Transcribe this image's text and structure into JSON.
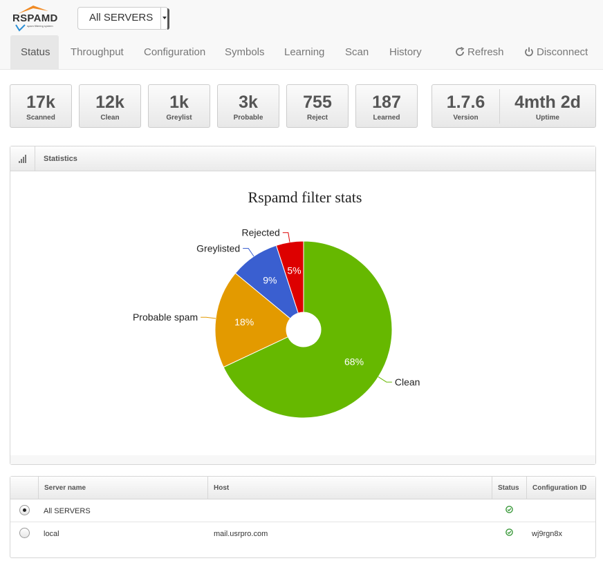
{
  "app": {
    "logo_text": "RSPAMD",
    "logo_tagline": "spam filtering system"
  },
  "server_select": {
    "value": "All SERVERS"
  },
  "nav": {
    "tabs": [
      {
        "label": "Status"
      },
      {
        "label": "Throughput"
      },
      {
        "label": "Configuration"
      },
      {
        "label": "Symbols"
      },
      {
        "label": "Learning"
      },
      {
        "label": "Scan"
      },
      {
        "label": "History"
      }
    ],
    "refresh_label": "Refresh",
    "disconnect_label": "Disconnect",
    "refresh_icon": "refresh-icon",
    "disconnect_icon": "power-icon"
  },
  "stats": [
    {
      "value": "17k",
      "label": "Scanned"
    },
    {
      "value": "12k",
      "label": "Clean"
    },
    {
      "value": "1k",
      "label": "Greylist"
    },
    {
      "value": "3k",
      "label": "Probable"
    },
    {
      "value": "755",
      "label": "Reject"
    },
    {
      "value": "187",
      "label": "Learned"
    }
  ],
  "info": {
    "version_value": "1.7.6",
    "version_label": "Version",
    "uptime_value": "4mth 2d",
    "uptime_label": "Uptime"
  },
  "statistics_panel": {
    "title": "Statistics",
    "icon": "signal-bars-icon"
  },
  "chart_data": {
    "type": "pie",
    "title": "Rspamd filter stats",
    "donut": true,
    "slices": [
      {
        "name": "Clean",
        "value": 68,
        "label": "68%",
        "color": "#66b800"
      },
      {
        "name": "Probable spam",
        "value": 18,
        "label": "18%",
        "color": "#e39a00"
      },
      {
        "name": "Greylisted",
        "value": 9,
        "label": "9%",
        "color": "#3a5fd0"
      },
      {
        "name": "Rejected",
        "value": 5,
        "label": "5%",
        "color": "#dd0000"
      }
    ]
  },
  "servers_table": {
    "headers": [
      "Server name",
      "Host",
      "Status",
      "Configuration ID"
    ],
    "rows": [
      {
        "selected": true,
        "name": "All SERVERS",
        "host": "",
        "status": "ok",
        "config_id": ""
      },
      {
        "selected": false,
        "name": "local",
        "host": "mail.usrpro.com",
        "status": "ok",
        "config_id": "wj9rgn8x"
      }
    ]
  },
  "colors": {
    "status_ok": "#3c9a3c"
  }
}
